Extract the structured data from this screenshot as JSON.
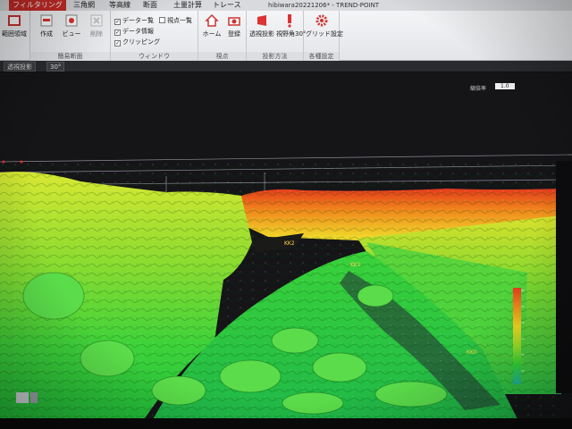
{
  "window": {
    "title": "hibiwara20221206* - TREND-POINT"
  },
  "ribbon_tabs": [
    {
      "label": "フィルタリング",
      "active": true
    },
    {
      "label": "三角網",
      "active": false
    },
    {
      "label": "等高線",
      "active": false
    },
    {
      "label": "断面",
      "active": false
    },
    {
      "label": "土量計算",
      "active": false
    },
    {
      "label": "トレース",
      "active": false
    }
  ],
  "ribbon": {
    "groups": [
      {
        "label": "",
        "buttons": [
          {
            "label": "範囲領域"
          }
        ]
      },
      {
        "label": "簡易断面",
        "buttons": [
          {
            "label": "作成"
          },
          {
            "label": "ビュー"
          },
          {
            "label": "削除"
          }
        ]
      },
      {
        "label": "ウィンドウ",
        "checks": [
          {
            "label": "データー覧",
            "checked": true
          },
          {
            "label": "データ情報",
            "checked": true
          },
          {
            "label": "クリッピング",
            "checked": true
          },
          {
            "label": "視点一覧",
            "checked": false
          }
        ]
      },
      {
        "label": "視点",
        "buttons": [
          {
            "label": "ホーム"
          },
          {
            "label": "登録"
          }
        ]
      },
      {
        "label": "投影方法",
        "buttons": [
          {
            "label": "透視投影"
          },
          {
            "label": "視野角30°"
          }
        ]
      },
      {
        "label": "各種設定",
        "buttons": [
          {
            "label": "グリッド設定"
          }
        ]
      }
    ]
  },
  "viewbar": {
    "projection": "透視投影",
    "fov": "30°"
  },
  "right_toolbar": {
    "label": "縮倍率",
    "value": "1.0"
  },
  "point_labels": [
    "KK2",
    "KK1",
    "KK0"
  ],
  "legend": {
    "colors": [
      "#e53a1e",
      "#f08a1a",
      "#f2d51f",
      "#9fe02a",
      "#2fd636",
      "#21b8a0"
    ]
  }
}
